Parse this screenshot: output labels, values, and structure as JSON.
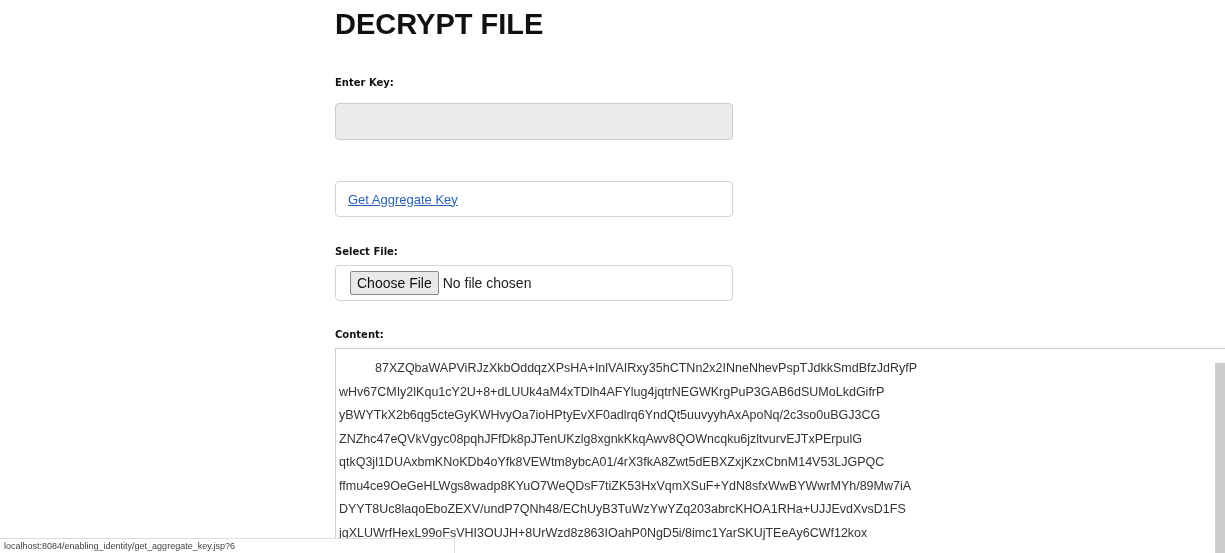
{
  "title": "DECRYPT FILE",
  "key_field": {
    "label": "Enter Key:",
    "disabled": true
  },
  "aggregate_link": {
    "label": "Get Aggregate Key"
  },
  "file_field": {
    "label": "Select File:",
    "button": "Choose File",
    "status": "No file chosen"
  },
  "content": {
    "label": "Content:",
    "lines": [
      "87XZQbaWAPViRJzXkbOddqzXPsHA+InlVAIRxy35hCTNn2x2INneNhevPspTJdkkSmdBfzJdRyfP",
      "wHv67CMIy2lKqu1cY2U+8+dLUUk4aM4xTDlh4AFYlug4jqtrNEGWKrgPuP3GAB6dSUMoLkdGifrP",
      "yBWYTkX2b6qg5cteGyKWHvyOa7ioHPtyEvXF0adlrq6YndQt5uuvyyhAxApoNq/2c3so0uBGJ3CG",
      "ZNZhc47eQVkVgyc08pqhJFfDk8pJTenUKzlg8xgnkKkqAwv8QOWncqku6jzltvurvEJTxPErpulG",
      "qtkQ3jl1DUAxbmKNoKDb4oYfk8VEWtm8ybcA01/4rX3fkA8Zwt5dEBXZxjKzxCbnM14V53LJGPQC",
      "ffmu4ce9OeGeHLWgs8wadp8KYuO7WeQDsF7tiZK53HxVqmXSuF+YdN8sfxWwBYWwrMYh/89Mw7iA",
      "DYYT8Uc8laqoEboZEXV/undP7QNh48/EChUyB3TuWzYwYZq203abrcKHOA1RHa+UJJEvdXvsD1FS",
      "jqXLUWrfHexL99oFsVHI3OUJH+8UrWzd8z863IOahP0NgD5i/8imc1YarSKUjTEeAy6CWf12kox"
    ]
  },
  "status_bar": {
    "url": "localhost:8084/enabling_identity/get_aggregate_key.jsp?6"
  }
}
